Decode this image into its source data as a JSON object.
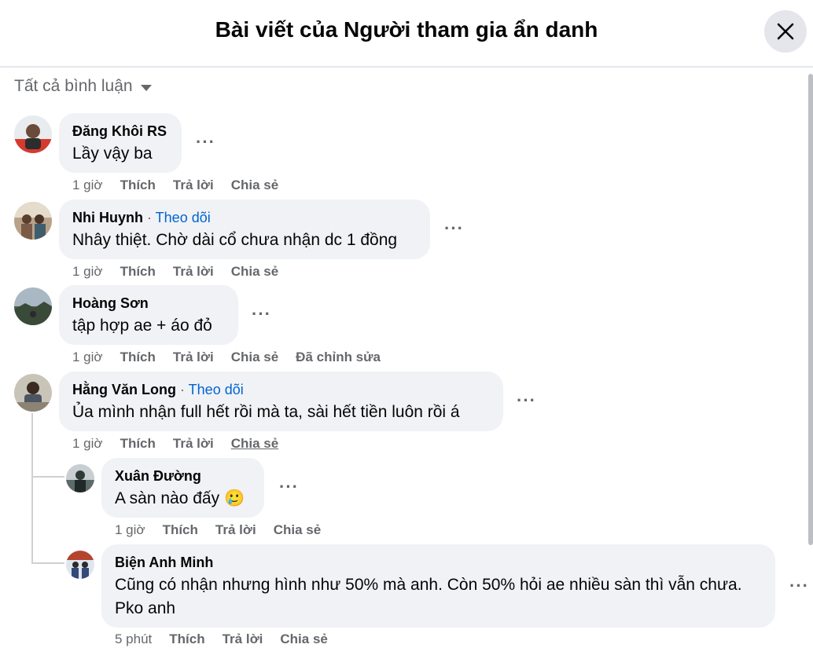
{
  "header": {
    "title": "Bài viết của Người tham gia ẩn danh"
  },
  "filter": {
    "label": "Tất cả bình luận"
  },
  "comments": [
    {
      "name": "Đăng Khôi RS",
      "text": "Lầy vậy ba",
      "time": "1 giờ",
      "like": "Thích",
      "reply": "Trả lời",
      "share": "Chia sẻ"
    },
    {
      "name": "Nhi Huynh",
      "follow": "Theo dõi",
      "text": "Nhây thiệt. Chờ dài cổ chưa nhận dc 1 đồng",
      "time": "1 giờ",
      "like": "Thích",
      "reply": "Trả lời",
      "share": "Chia sẻ"
    },
    {
      "name": "Hoàng Sơn",
      "text": "tập hợp ae + áo đỏ",
      "time": "1 giờ",
      "like": "Thích",
      "reply": "Trả lời",
      "share": "Chia sẻ",
      "edited": "Đã chỉnh sửa"
    },
    {
      "name": "Hằng Văn Long",
      "follow": "Theo dõi",
      "text": "Ủa mình nhận full hết rồi mà ta, sài hết tiền luôn rồi á",
      "time": "1 giờ",
      "like": "Thích",
      "reply": "Trả lời",
      "share": "Chia sẻ"
    },
    {
      "name": "Xuân Đường",
      "text": "A sàn nào đấy",
      "emoji": "🥲",
      "time": "1 giờ",
      "like": "Thích",
      "reply": "Trả lời",
      "share": "Chia sẻ"
    },
    {
      "name": "Biện Anh Minh",
      "text": "Cũng có nhận nhưng hình như 50% mà anh. Còn 50% hỏi ae nhiều sàn thì vẫn chưa. Pko anh",
      "time": "5 phút",
      "like": "Thích",
      "reply": "Trả lời",
      "share": "Chia sẻ"
    }
  ],
  "colors": {
    "bubble": "#f0f2f5",
    "link": "#0064d1",
    "meta": "#65676b"
  }
}
